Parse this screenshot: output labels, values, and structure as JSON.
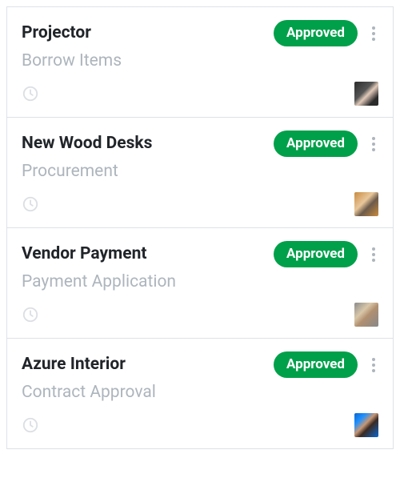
{
  "cards": [
    {
      "title": "Projector",
      "subtitle": "Borrow Items",
      "status": "Approved",
      "avatar_class": "av1"
    },
    {
      "title": "New Wood Desks",
      "subtitle": "Procurement",
      "status": "Approved",
      "avatar_class": "av2"
    },
    {
      "title": "Vendor Payment",
      "subtitle": "Payment Application",
      "status": "Approved",
      "avatar_class": "av3"
    },
    {
      "title": "Azure Interior",
      "subtitle": "Contract Approval",
      "status": "Approved",
      "avatar_class": "av4"
    }
  ],
  "status_color": "#00a04a"
}
